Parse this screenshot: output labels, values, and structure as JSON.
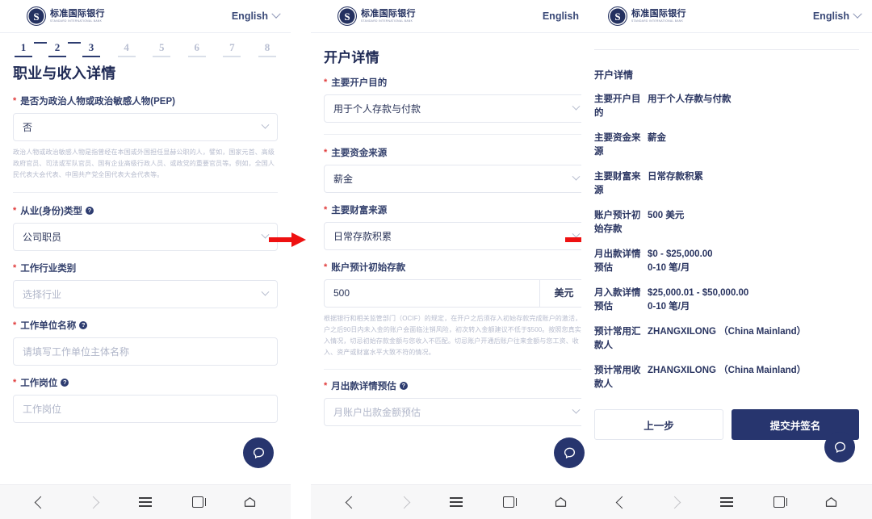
{
  "brand": {
    "logo_cn": "标准国际银行",
    "logo_en": "STANDARD INTERNATIONAL BANK",
    "logo_letter": "S",
    "accent_dark": "#27356e",
    "accent_text": "#2a3561",
    "required_red": "#e03a3a",
    "arrow_red": "#ee1111"
  },
  "header": {
    "language_label": "English",
    "language_caret_icon": "chevron-down-icon"
  },
  "panel1": {
    "steps": [
      {
        "num": "1",
        "active": true
      },
      {
        "num": "2",
        "active": true
      },
      {
        "num": "3",
        "active": true
      },
      {
        "num": "4",
        "active": false
      },
      {
        "num": "5",
        "active": false
      },
      {
        "num": "6",
        "active": false
      },
      {
        "num": "7",
        "active": false
      },
      {
        "num": "8",
        "active": false
      }
    ],
    "title": "职业与收入详情",
    "fields": {
      "pep_label": "是否为政治人物或政治敏感人物(PEP)",
      "pep_value": "否",
      "pep_hint": "政治人物或政治敏感人物是指曾经在本国或外国担任显赫公职的人，譬如，国家元首、高级政府官员、司法或军队官员、国有企业高级行政人员、或政党的重要官员等。例如，全国人民代表大会代表、中国共产党全国代表大会代表等。",
      "employment_label": "从业(身份)类型",
      "employment_value": "公司职员",
      "industry_label": "工作行业类别",
      "industry_placeholder": "选择行业",
      "employer_label": "工作单位名称",
      "employer_placeholder": "请填写工作单位主体名称",
      "position_label": "工作岗位",
      "position_placeholder": "工作岗位"
    }
  },
  "panel2": {
    "title": "开户详情",
    "fields": {
      "purpose_label": "主要开户目的",
      "purpose_value": "用于个人存款与付款",
      "fund_source_label": "主要资金来源",
      "fund_source_value": "薪金",
      "wealth_source_label": "主要财富来源",
      "wealth_source_value": "日常存款积累",
      "initial_deposit_label": "账户预计初始存款",
      "initial_deposit_value": "500",
      "initial_deposit_currency": "美元",
      "initial_deposit_hint": "根据银行和相关监管部门（OCIF）的规定，在开户之后须存入初始存款完成账户的激活，开户之后90日内未入金的账户会面临注销风险，初次转入金额建议不低于$500。按照您真实收入情况，切忌初始存款金额与您收入不匹配。切忌账户开通后账户往来金额与您工资、收入、资产或财富水平大致不符的情况。",
      "monthly_out_label": "月出款详情预估",
      "monthly_out_placeholder": "月账户出款金额预估"
    }
  },
  "panel3": {
    "section_title": "开户详情",
    "rows": [
      {
        "key": "主要开户目的",
        "value_line1": "用于个人存款与付款",
        "value_line2": ""
      },
      {
        "key": "主要资金来源",
        "value_line1": "薪金",
        "value_line2": ""
      },
      {
        "key": "主要财富来源",
        "value_line1": "日常存款积累",
        "value_line2": ""
      },
      {
        "key": "账户预计初始存款",
        "value_line1": "500 美元",
        "value_line2": ""
      },
      {
        "key": "月出款详情预估",
        "value_line1": "$0 - $25,000.00",
        "value_line2": "0-10 笔/月"
      },
      {
        "key": "月入款详情预估",
        "value_line1": "$25,000.01 - $50,000.00",
        "value_line2": "0-10 笔/月"
      },
      {
        "key": "预计常用汇款人",
        "value_line1": "ZHANGXILONG （China Mainland）",
        "value_line2": ""
      },
      {
        "key": "预计常用收款人",
        "value_line1": "ZHANGXILONG （China Mainland）",
        "value_line2": ""
      }
    ],
    "back_button": "上一步",
    "submit_button": "提交并签名"
  },
  "chat": {
    "icon": "chat-bubble-icon"
  },
  "navbar": {
    "back_icon": "chevron-left-icon",
    "forward_icon": "chevron-right-icon",
    "menu_icon": "hamburger-menu-icon",
    "tabs_icon": "tabs-square-icon",
    "home_icon": "home-icon"
  },
  "arrows": {
    "arrow1_icon": "right-arrow-icon",
    "arrow2_icon": "right-arrow-icon"
  }
}
